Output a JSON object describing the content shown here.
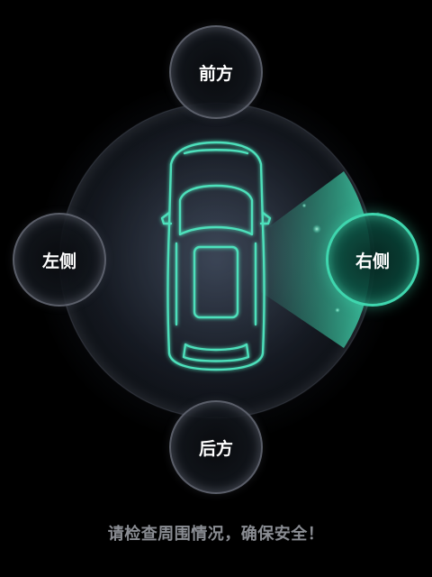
{
  "buttons": {
    "front": "前方",
    "left": "左侧",
    "right": "右侧",
    "rear": "后方"
  },
  "active_direction": "right",
  "hint_text": "请检查周围情况，确保安全！",
  "colors": {
    "accent": "#3fd6ae",
    "background": "#000000",
    "hint": "#8a8d93",
    "button_text": "#ffffff"
  }
}
